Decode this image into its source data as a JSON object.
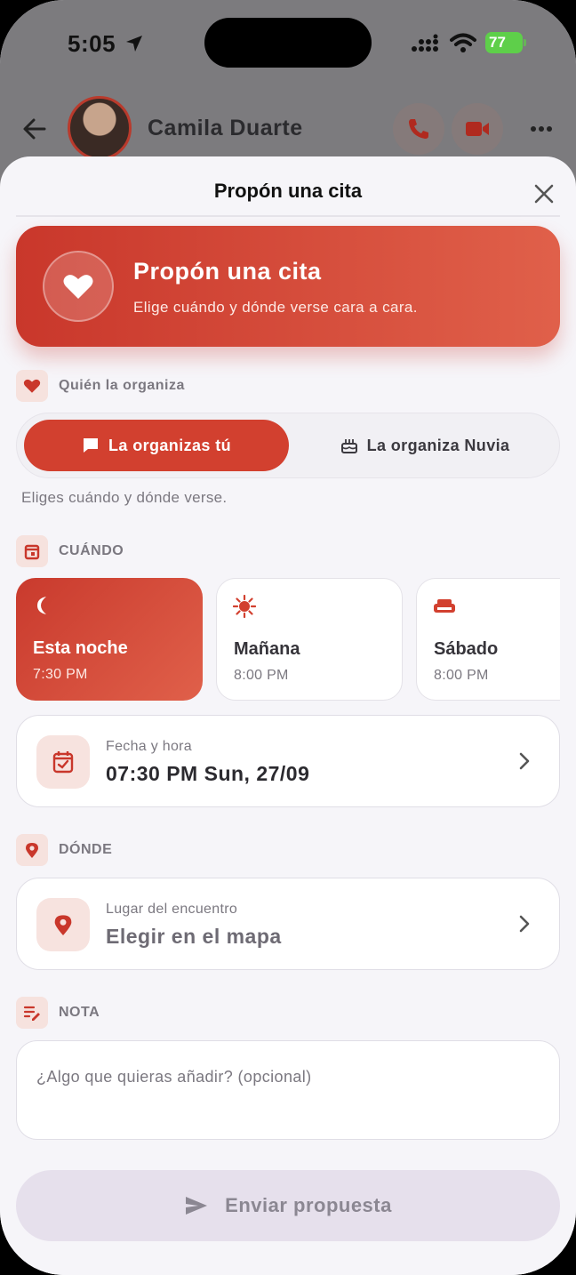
{
  "status_bar": {
    "time": "5:05",
    "battery": "77"
  },
  "chat_header": {
    "contact_name": "Camila Duarte"
  },
  "sheet": {
    "title": "Propón una cita"
  },
  "hero": {
    "title": "Propón una cita",
    "subtitle": "Elige cuándo y dónde verse cara a cara."
  },
  "organizer": {
    "label": "Quién la organiza",
    "options": [
      "La organizas tú",
      "La organiza Nuvia"
    ],
    "selected": "La organizas tú",
    "hint": "Eliges cuándo y dónde verse."
  },
  "when": {
    "label": "CUÁNDO",
    "options": [
      {
        "title": "Esta noche",
        "time": "7:30 PM",
        "icon": "moon-icon",
        "selected": true
      },
      {
        "title": "Mañana",
        "time": "8:00 PM",
        "icon": "sun-icon",
        "selected": false
      },
      {
        "title": "Sábado",
        "time": "8:00 PM",
        "icon": "sofa-icon",
        "selected": false
      }
    ],
    "datetime_label": "Fecha y hora",
    "datetime_value": "07:30 PM Sun, 27/09"
  },
  "where": {
    "label": "DÓNDE",
    "place_label": "Lugar del encuentro",
    "place_value": "Elegir en el mapa"
  },
  "note": {
    "label": "NOTA",
    "placeholder": "¿Algo que quieras añadir? (opcional)"
  },
  "send": {
    "label": "Enviar propuesta"
  },
  "colors": {
    "accent": "#d2402f",
    "accent_light": "#e0604a",
    "soft": "#f6e2de",
    "background": "#f6f5f9"
  }
}
